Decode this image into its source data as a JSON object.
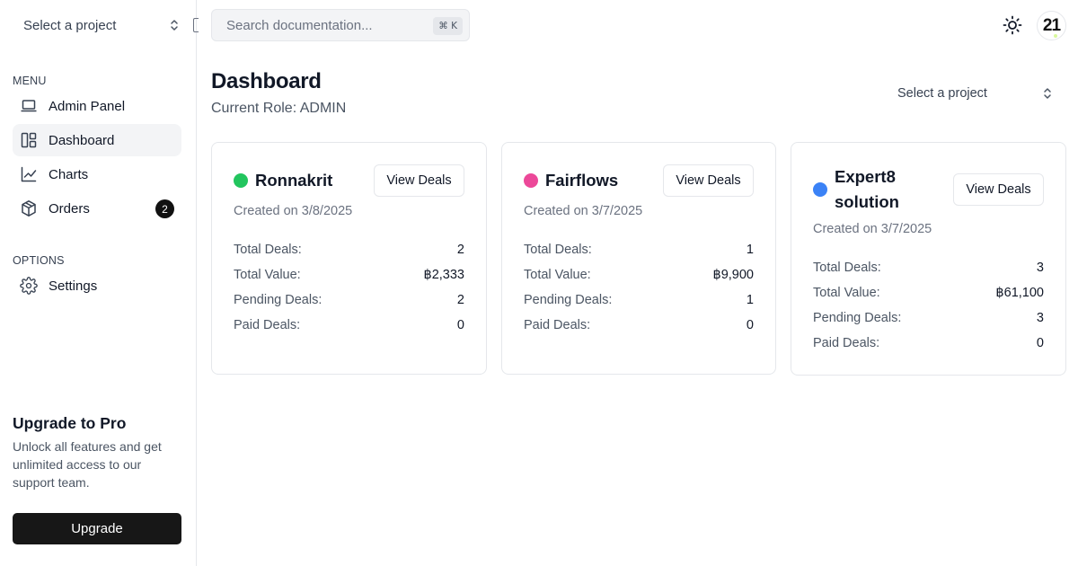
{
  "sidebar": {
    "project_switcher": "Select a project",
    "menu_label": "MENU",
    "menu_items": [
      {
        "label": "Admin Panel",
        "icon": "laptop-icon"
      },
      {
        "label": "Dashboard",
        "icon": "layout-dashboard-icon",
        "active": true
      },
      {
        "label": "Charts",
        "icon": "line-chart-icon"
      },
      {
        "label": "Orders",
        "icon": "package-icon",
        "badge": "2"
      }
    ],
    "options_label": "OPTIONS",
    "options_items": [
      {
        "label": "Settings",
        "icon": "gear-icon"
      }
    ],
    "promo": {
      "title": "Upgrade to Pro",
      "text": "Unlock all features and get unlimited access to our support team.",
      "button": "Upgrade"
    }
  },
  "header": {
    "search_placeholder": "Search documentation...",
    "search_shortcut": "⌘ K",
    "theme_icon": "sun-icon",
    "avatar_text": "21"
  },
  "page": {
    "title": "Dashboard",
    "role": "Current Role: ADMIN",
    "project_select": "Select a project"
  },
  "cards": [
    {
      "name": "Ronnakrit",
      "color": "#22c55e",
      "created": "Created on 3/8/2025",
      "button": "View Deals",
      "stats": [
        {
          "label": "Total Deals:",
          "value": "2"
        },
        {
          "label": "Total Value:",
          "value": "฿2,333"
        },
        {
          "label": "Pending Deals:",
          "value": "2"
        },
        {
          "label": "Paid Deals:",
          "value": "0"
        }
      ]
    },
    {
      "name": "Fairflows",
      "color": "#ec4899",
      "created": "Created on 3/7/2025",
      "button": "View Deals",
      "stats": [
        {
          "label": "Total Deals:",
          "value": "1"
        },
        {
          "label": "Total Value:",
          "value": "฿9,900"
        },
        {
          "label": "Pending Deals:",
          "value": "1"
        },
        {
          "label": "Paid Deals:",
          "value": "0"
        }
      ]
    },
    {
      "name_line1": "Expert8",
      "name_line2": "solution",
      "color": "#3b82f6",
      "created": "Created on 3/7/2025",
      "button": "View Deals",
      "stats": [
        {
          "label": "Total Deals:",
          "value": "3"
        },
        {
          "label": "Total Value:",
          "value": "฿61,100"
        },
        {
          "label": "Pending Deals:",
          "value": "3"
        },
        {
          "label": "Paid Deals:",
          "value": "0"
        }
      ]
    }
  ]
}
